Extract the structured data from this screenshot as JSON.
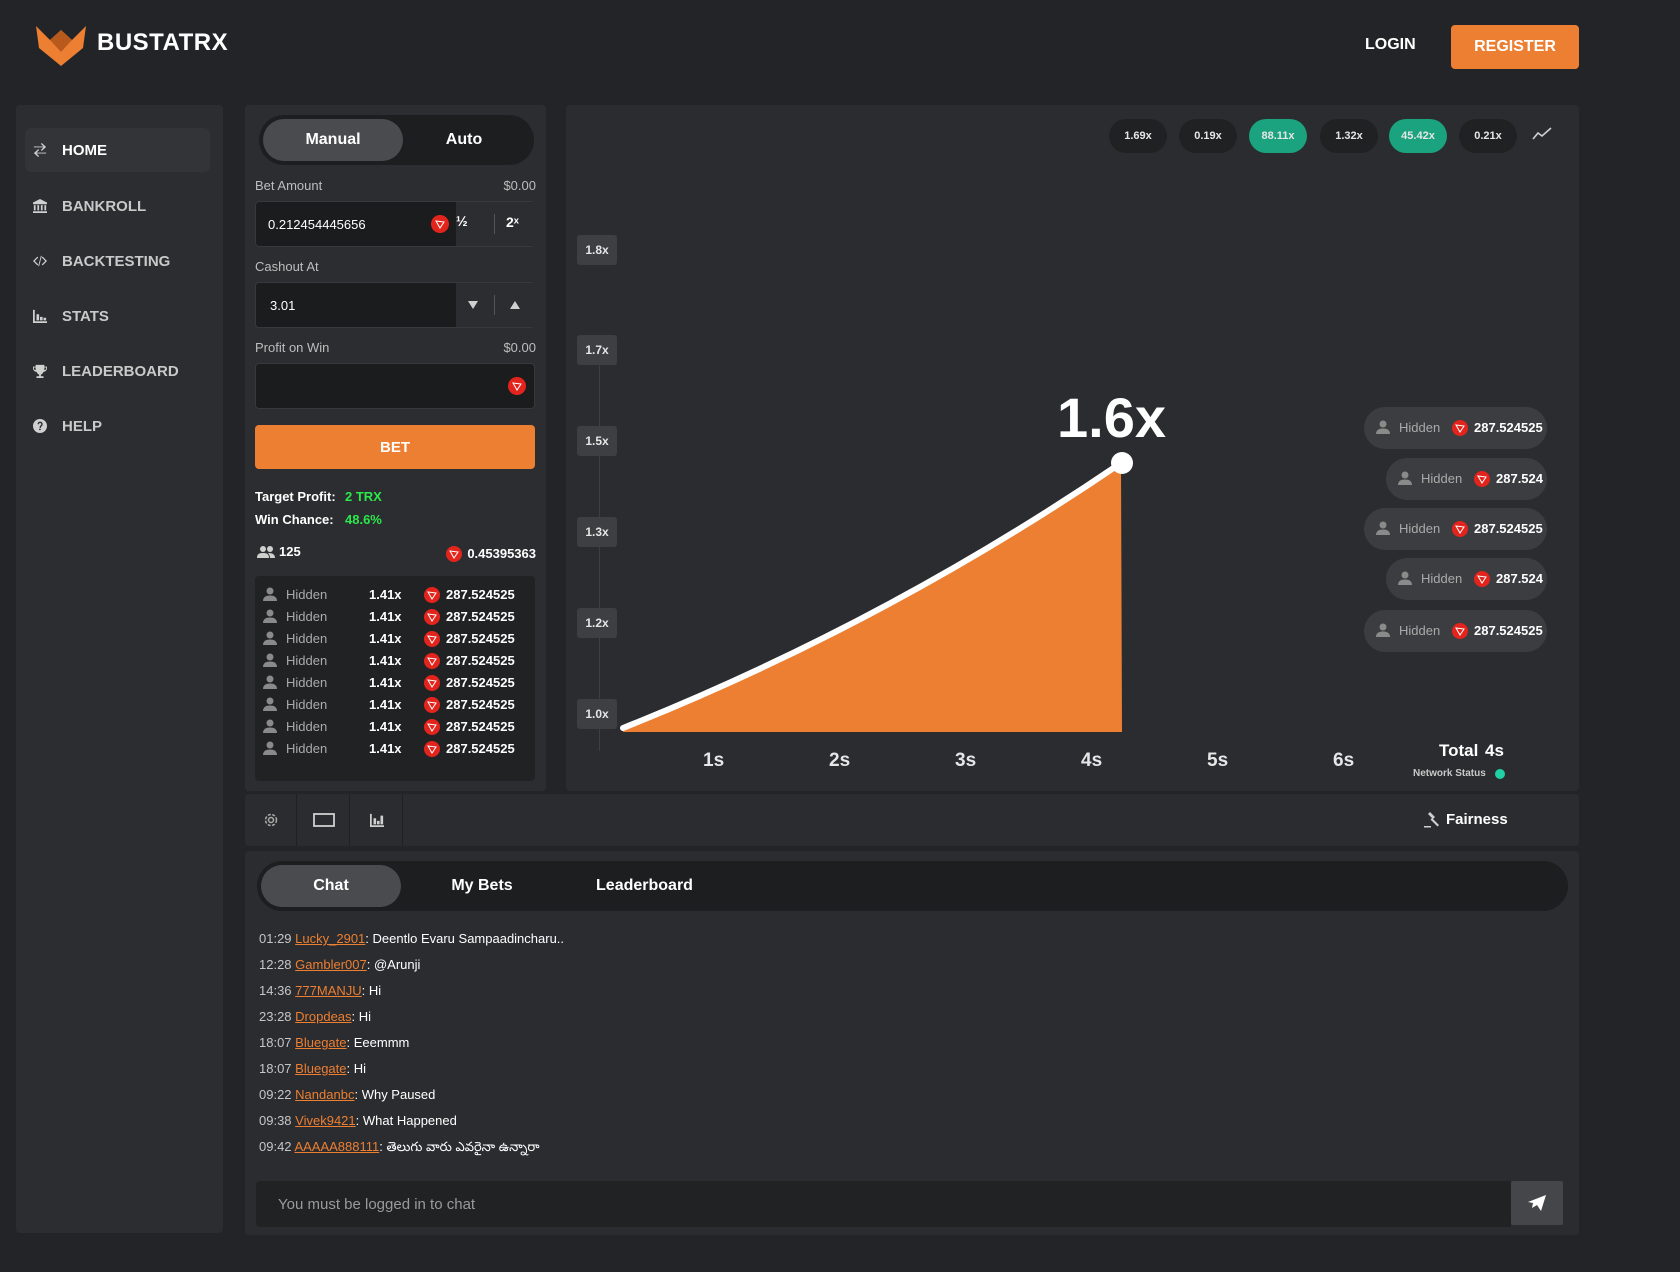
{
  "header": {
    "brand": "BUSTATRX",
    "login_label": "LOGIN",
    "register_label": "REGISTER",
    "accent_color": "#ec7f32"
  },
  "sidebar": {
    "items": [
      {
        "label": "HOME",
        "icon": "swap-arrows-icon",
        "active": true
      },
      {
        "label": "BANKROLL",
        "icon": "bank-icon"
      },
      {
        "label": "BACKTESTING",
        "icon": "code-icon"
      },
      {
        "label": "STATS",
        "icon": "bar-chart-icon"
      },
      {
        "label": "LEADERBOARD",
        "icon": "trophy-icon"
      },
      {
        "label": "HELP",
        "icon": "question-icon"
      }
    ]
  },
  "bet_panel": {
    "tabs": [
      "Manual",
      "Auto"
    ],
    "bet_amount_label": "Bet Amount",
    "bet_amount_usd": "$0.00",
    "bet_amount_value": "0.212454445656",
    "half_label": "½",
    "double_label": "2ˣ",
    "cashout_label": "Cashout At",
    "cashout_value": "3.01",
    "profit_label": "Profit on Win",
    "profit_usd": "$0.00",
    "profit_value": "",
    "bet_button": "BET",
    "target_profit_label": "Target Profit:",
    "target_profit_value": "2 TRX",
    "win_chance_label": "Win Chance:",
    "win_chance_value": "48.6%",
    "player_count": "125",
    "total_bet": "0.45395363",
    "players": [
      {
        "name": "Hidden",
        "mult": "1.41x",
        "amount": "287.524525"
      },
      {
        "name": "Hidden",
        "mult": "1.41x",
        "amount": "287.524525"
      },
      {
        "name": "Hidden",
        "mult": "1.41x",
        "amount": "287.524525"
      },
      {
        "name": "Hidden",
        "mult": "1.41x",
        "amount": "287.524525"
      },
      {
        "name": "Hidden",
        "mult": "1.41x",
        "amount": "287.524525"
      },
      {
        "name": "Hidden",
        "mult": "1.41x",
        "amount": "287.524525"
      },
      {
        "name": "Hidden",
        "mult": "1.41x",
        "amount": "287.524525"
      },
      {
        "name": "Hidden",
        "mult": "1.41x",
        "amount": "287.524525"
      }
    ]
  },
  "game": {
    "history": [
      {
        "label": "1.69x",
        "green": false
      },
      {
        "label": "0.19x",
        "green": false
      },
      {
        "label": "88.11x",
        "green": true
      },
      {
        "label": "1.32x",
        "green": false
      },
      {
        "label": "45.42x",
        "green": true
      },
      {
        "label": "0.21x",
        "green": false
      }
    ],
    "current_multiplier": "1.6x",
    "y_ticks": [
      "1.8x",
      "1.7x",
      "1.5x",
      "1.3x",
      "1.2x",
      "1.0x"
    ],
    "x_ticks": [
      "1s",
      "2s",
      "3s",
      "4s",
      "5s",
      "6s"
    ],
    "total_label": "Total",
    "total_value": "4s",
    "network_status_label": "Network Status",
    "network_status_color": "#1fd1a5",
    "cashouts": [
      {
        "name": "Hidden",
        "amount": "287.524525"
      },
      {
        "name": "Hidden",
        "amount": "287.524"
      },
      {
        "name": "Hidden",
        "amount": "287.524525"
      },
      {
        "name": "Hidden",
        "amount": "287.524"
      },
      {
        "name": "Hidden",
        "amount": "287.524525"
      }
    ]
  },
  "toolbar": {
    "fairness_label": "Fairness"
  },
  "chat": {
    "tabs": [
      "Chat",
      "My Bets",
      "Leaderboard"
    ],
    "messages": [
      {
        "time": "01:29",
        "user": "Lucky_2901",
        "text": "Deentlo Evaru Sampaadincharu.."
      },
      {
        "time": "12:28",
        "user": "Gambler007",
        "text": "@Arunji"
      },
      {
        "time": "14:36",
        "user": "777MANJU",
        "text": "Hi"
      },
      {
        "time": "23:28",
        "user": "Dropdeas",
        "text": "Hi"
      },
      {
        "time": "18:07",
        "user": "Bluegate",
        "text": "Eeemmm"
      },
      {
        "time": "18:07",
        "user": "Bluegate",
        "text": "Hi"
      },
      {
        "time": "09:22",
        "user": "Nandanbc",
        "text": "Why Paused"
      },
      {
        "time": "09:38",
        "user": "Vivek9421",
        "text": "What Happened"
      },
      {
        "time": "09:42",
        "user": "AAAAA888111",
        "text": "తెలుగు వారు ఎవరైనా ఉన్నారా"
      }
    ],
    "input_placeholder": "You must be logged in to chat"
  }
}
